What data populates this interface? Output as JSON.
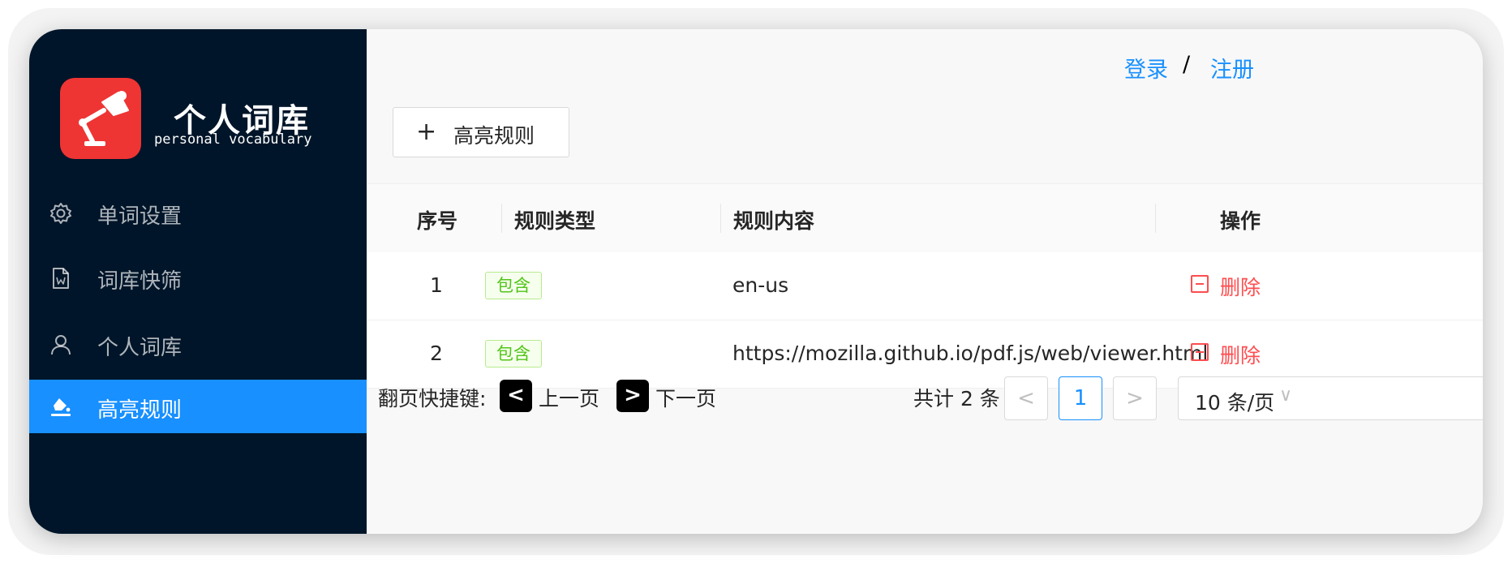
{
  "app": {
    "title": "个人词库",
    "subtitle": "personal vocabulary"
  },
  "sidebar": {
    "items": [
      {
        "label": "单词设置",
        "icon": "gear-icon"
      },
      {
        "label": "词库快筛",
        "icon": "word-document-icon"
      },
      {
        "label": "个人词库",
        "icon": "user-icon"
      },
      {
        "label": "高亮规则",
        "icon": "highlighter-icon",
        "active": true
      }
    ]
  },
  "header": {
    "login": "登录",
    "separator": "/",
    "register": "注册"
  },
  "toolbar": {
    "add_plus": "+",
    "add_label": "高亮规则"
  },
  "table": {
    "columns": [
      "序号",
      "规则类型",
      "规则内容",
      "操作"
    ],
    "rows": [
      {
        "index": "1",
        "type": "包含",
        "content": "en-us",
        "action": "删除"
      },
      {
        "index": "2",
        "type": "包含",
        "content": "https://mozilla.github.io/pdf.js/web/viewer.html",
        "action": "删除"
      }
    ]
  },
  "footer": {
    "shortcut_label": "翻页快捷键:",
    "prev_key": "<",
    "prev_label": "上一页",
    "next_key": ">",
    "next_label": "下一页",
    "total_text": "共计 2 条",
    "prev_page": "<",
    "current_page": "1",
    "next_page": ">",
    "page_size": "10 条/页",
    "page_size_chevron": "∨"
  },
  "colors": {
    "sidebar_bg": "#001529",
    "accent": "#1890ff",
    "danger": "#ff4d4f",
    "tag_green": "#52c41a",
    "logo_red": "#ef3434"
  }
}
